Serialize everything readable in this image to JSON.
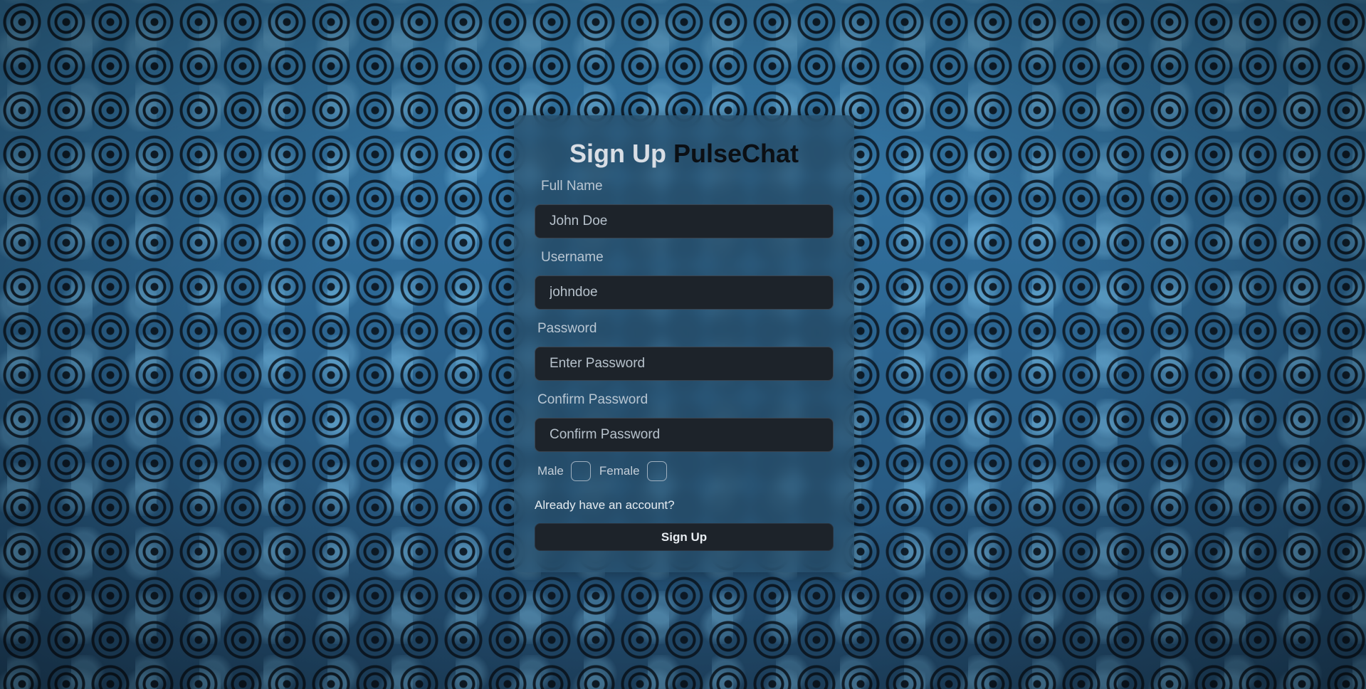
{
  "form": {
    "title_part1": "Sign Up",
    "title_part2": "PulseChat",
    "full_name": {
      "label": "Full Name",
      "placeholder": "John Doe"
    },
    "username": {
      "label": "Username",
      "placeholder": "johndoe"
    },
    "password": {
      "label": "Password",
      "placeholder": "Enter Password"
    },
    "confirm_password": {
      "label": "Confirm Password",
      "placeholder": "Confirm Password"
    },
    "gender": {
      "male_label": "Male",
      "female_label": "Female"
    },
    "login_link": "Already have an account?",
    "submit_label": "Sign Up"
  }
}
